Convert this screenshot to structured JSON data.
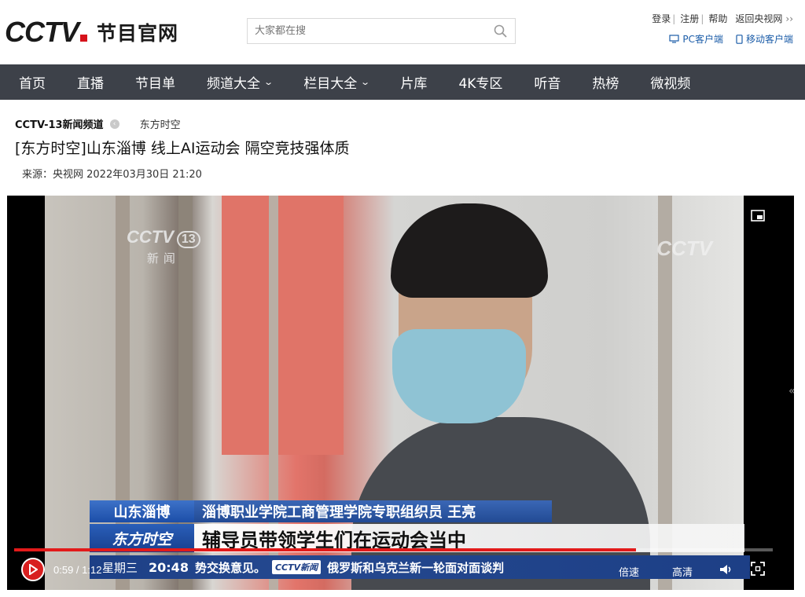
{
  "header": {
    "logo_text": "CCTV",
    "logo_sub": "节目官网",
    "search_placeholder": "大家都在搜",
    "links": {
      "login": "登录",
      "register": "注册",
      "help": "帮助",
      "back": "返回央视网"
    },
    "pc_client": "PC客户端",
    "mobile_client": "移动客户端"
  },
  "nav": {
    "items": [
      {
        "label": "首页",
        "dropdown": false
      },
      {
        "label": "直播",
        "dropdown": false
      },
      {
        "label": "节目单",
        "dropdown": false
      },
      {
        "label": "频道大全",
        "dropdown": true
      },
      {
        "label": "栏目大全",
        "dropdown": true
      },
      {
        "label": "片库",
        "dropdown": false
      },
      {
        "label": "4K专区",
        "dropdown": false
      },
      {
        "label": "听音",
        "dropdown": false
      },
      {
        "label": "热榜",
        "dropdown": false
      },
      {
        "label": "微视频",
        "dropdown": false
      }
    ]
  },
  "article": {
    "channel": "CCTV-13新闻频道",
    "program": "东方时空",
    "title": "[东方时空]山东淄博 线上AI运动会 隔空竞技强体质",
    "meta": "来源：央视网 2022年03月30日 21:20"
  },
  "video": {
    "watermark_left": "CCTV",
    "watermark_left_channel": "13",
    "watermark_left_sub": "新闻",
    "watermark_right": "CCTV",
    "lower_third": {
      "location": "山东淄博",
      "name": "淄博职业学院工商管理学院专职组织员  王亮",
      "program": "东方时空",
      "subtitle": "辅导员带领学生们在运动会当中"
    },
    "ticker": {
      "day": "星期三",
      "time": "20:48",
      "text_left": "势交换意见。",
      "logo": "CCTV新闻",
      "text_right": "俄罗斯和乌克兰新一轮面对面谈判"
    }
  },
  "player": {
    "time": "0:59 / 1:12",
    "progress": 0.82,
    "speed_label": "倍速",
    "quality_label": "高清",
    "colors": {
      "accent": "#e21a1a",
      "nav_bg": "#3d4149",
      "link": "#1b5ca8"
    }
  }
}
